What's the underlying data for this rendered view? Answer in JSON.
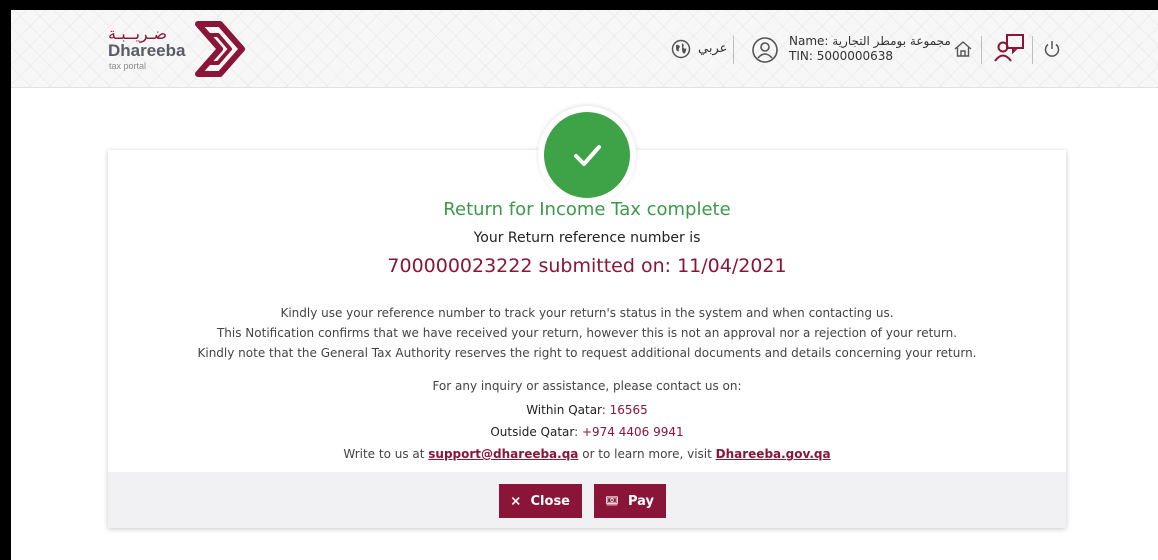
{
  "header": {
    "logo": {
      "arabic": "ضـريــبـة",
      "english": "Dhareeba",
      "subtitle": "tax portal"
    },
    "language_label": "عربي",
    "user": {
      "name": "Name: مجموعة بومطر التجارية",
      "tin": "TIN: 5000000638"
    },
    "icons": [
      "globe-icon",
      "user-icon",
      "home-icon",
      "switch-account-icon",
      "power-icon"
    ]
  },
  "confirmation": {
    "title": "Return for Income Tax complete",
    "reference_intro": "Your Return reference number is",
    "reference_line": "700000023222 submitted on: 11/04/2021",
    "notes": [
      "Kindly use your reference number to track your return's status in the system and when contacting us.",
      "This Notification confirms that we have received your return, however this is not an approval nor a rejection of your return.",
      "Kindly note that the General Tax Authority reserves the right to request additional documents and details concerning your return."
    ],
    "inquiry": "For any inquiry or assistance, please contact us on:",
    "within_label": "Within Qatar",
    "within_number": ": 16565",
    "outside_label": "Outside Qatar",
    "outside_number": ": +974 4406 9941",
    "write_prefix": "Write to us at ",
    "email": "support@dhareeba.qa",
    "write_middle": " or to learn more, visit ",
    "website": "Dhareeba.gov.qa"
  },
  "actions": {
    "close_label": "Close",
    "pay_label": "Pay"
  },
  "colors": {
    "maroon": "#8a1538",
    "success_green": "#3da346",
    "title_green": "#3b9a4a"
  }
}
